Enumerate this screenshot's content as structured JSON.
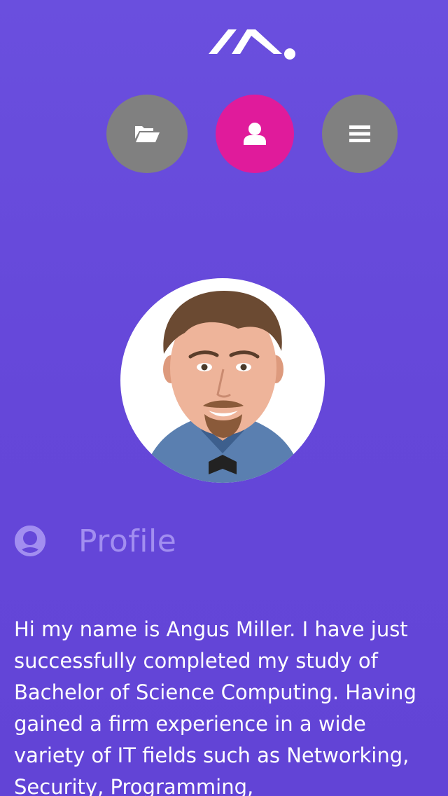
{
  "brand": {
    "logo_icon": "ma-logo-icon"
  },
  "nav": {
    "items": [
      {
        "name": "portfolio",
        "icon": "folder-open-icon",
        "color": "#808080"
      },
      {
        "name": "profile",
        "icon": "user-icon",
        "color": "#e01b9b",
        "active": true
      },
      {
        "name": "menu",
        "icon": "hamburger-menu-icon",
        "color": "#808080"
      }
    ]
  },
  "profile": {
    "photo_icon": "profile-photo",
    "section_icon": "user-circle-icon",
    "title": "Profile",
    "bio": "Hi my name is Angus Miller. I have just successfully completed my study of Bachelor of Science Computing. Having gained a firm experience in a wide variety of IT fields such as Networking, Security, Programming,"
  },
  "colors": {
    "background": "#6547d9",
    "accent": "#e01b9b",
    "muted": "#a28ef0"
  }
}
